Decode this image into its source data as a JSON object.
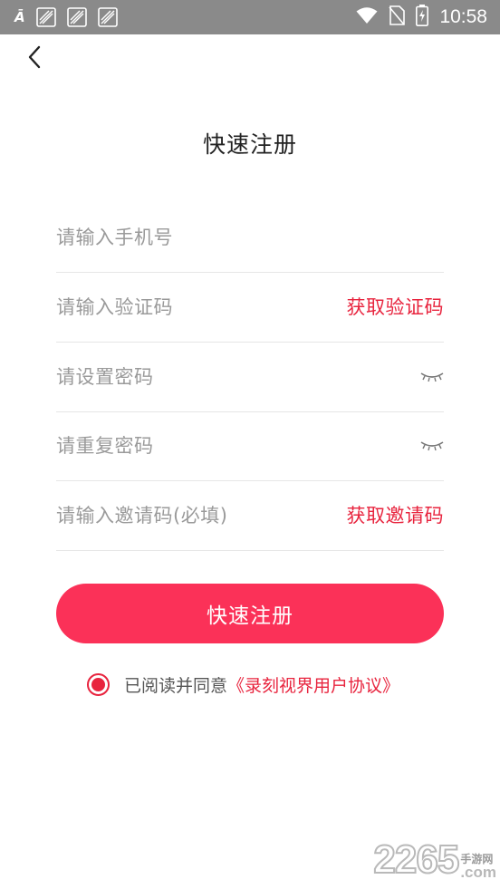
{
  "status_bar": {
    "time": "10:58",
    "left_icons": [
      "translate-icon",
      "app-notification-icon",
      "app-notification-icon",
      "app-notification-icon"
    ],
    "right_icons": [
      "wifi-icon",
      "no-sim-icon",
      "battery-charging-icon"
    ]
  },
  "header": {
    "title": "快速注册"
  },
  "form": {
    "phone": {
      "placeholder": "请输入手机号"
    },
    "code": {
      "placeholder": "请输入验证码",
      "action": "获取验证码"
    },
    "password": {
      "placeholder": "请设置密码"
    },
    "password_repeat": {
      "placeholder": "请重复密码"
    },
    "invite": {
      "placeholder": "请输入邀请码(必填)",
      "action": "获取邀请码"
    },
    "submit_label": "快速注册"
  },
  "agreement": {
    "checked": true,
    "text": "已阅读并同意",
    "link": "《录刻视界用户协议》"
  },
  "watermark": {
    "number": "2265",
    "site_cn": "手游网",
    "site_domain": ".com"
  },
  "colors": {
    "accent": "#e8243e",
    "button": "#fb3158",
    "placeholder": "#9a9a9a",
    "divider": "#e6e6e6"
  }
}
